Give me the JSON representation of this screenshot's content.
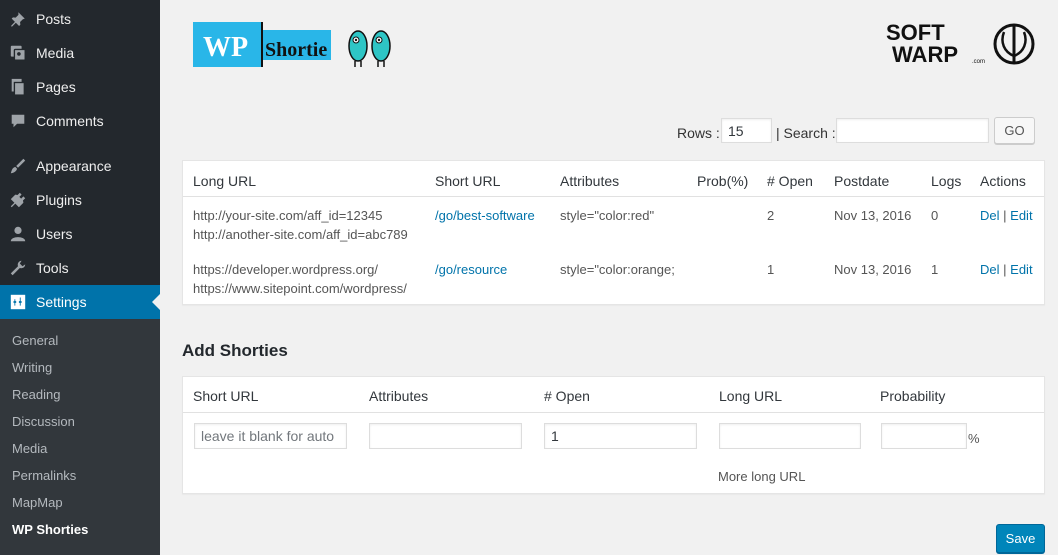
{
  "sidebar": {
    "menu": [
      {
        "label": "Posts",
        "icon": "pin-icon"
      },
      {
        "label": "Media",
        "icon": "media-icon"
      },
      {
        "label": "Pages",
        "icon": "pages-icon"
      },
      {
        "label": "Comments",
        "icon": "comment-icon"
      },
      {
        "label": "Appearance",
        "icon": "brush-icon"
      },
      {
        "label": "Plugins",
        "icon": "plug-icon"
      },
      {
        "label": "Users",
        "icon": "user-icon"
      },
      {
        "label": "Tools",
        "icon": "wrench-icon"
      },
      {
        "label": "Settings",
        "icon": "settings-icon"
      }
    ],
    "submenu": [
      "General",
      "Writing",
      "Reading",
      "Discussion",
      "Media",
      "Permalinks",
      "MapMap",
      "WP Shorties"
    ]
  },
  "logos": {
    "left_text_a": "WP",
    "left_text_b": "Shortie",
    "right_text_a": "SOFT",
    "right_text_b": "WARP",
    "right_text_c": ".com"
  },
  "controls": {
    "rows_label": "Rows :",
    "rows_value": "15",
    "search_label": "| Search :",
    "search_value": "",
    "go_label": "GO"
  },
  "list_table": {
    "headers": [
      "Long URL",
      "Short URL",
      "Attributes",
      "Prob(%)",
      "# Open",
      "Postdate",
      "Logs",
      "Actions"
    ],
    "rows": [
      {
        "long1": "http://your-site.com/aff_id=12345",
        "long2": "http://another-site.com/aff_id=abc789",
        "short": "/go/best-software",
        "attributes": "style=\"color:red\"",
        "prob": "",
        "open": "2",
        "postdate": "Nov 13, 2016",
        "logs": "0",
        "del": "Del",
        "sep": "|",
        "edit": "Edit"
      },
      {
        "long1": "https://developer.wordpress.org/",
        "long2": "https://www.sitepoint.com/wordpress/",
        "short": "/go/resource",
        "attributes": "style=\"color:orange;",
        "prob": "",
        "open": "1",
        "postdate": "Nov 13, 2016",
        "logs": "1",
        "del": "Del",
        "sep": "|",
        "edit": "Edit"
      }
    ]
  },
  "add_form": {
    "title": "Add Shorties",
    "headers": [
      "Short URL",
      "Attributes",
      "# Open",
      "Long URL",
      "Probability"
    ],
    "short_url_placeholder": "leave it blank for auto",
    "attributes_value": "",
    "open_value": "1",
    "long_url_value": "",
    "probability_value": "",
    "percent": "%",
    "more_long_url": "More long URL",
    "save_label": "Save"
  },
  "colors": {
    "sidebar_bg": "#23282d",
    "submenu_bg": "#32373c",
    "accent": "#0073aa",
    "primary_button": "#0085ba"
  }
}
